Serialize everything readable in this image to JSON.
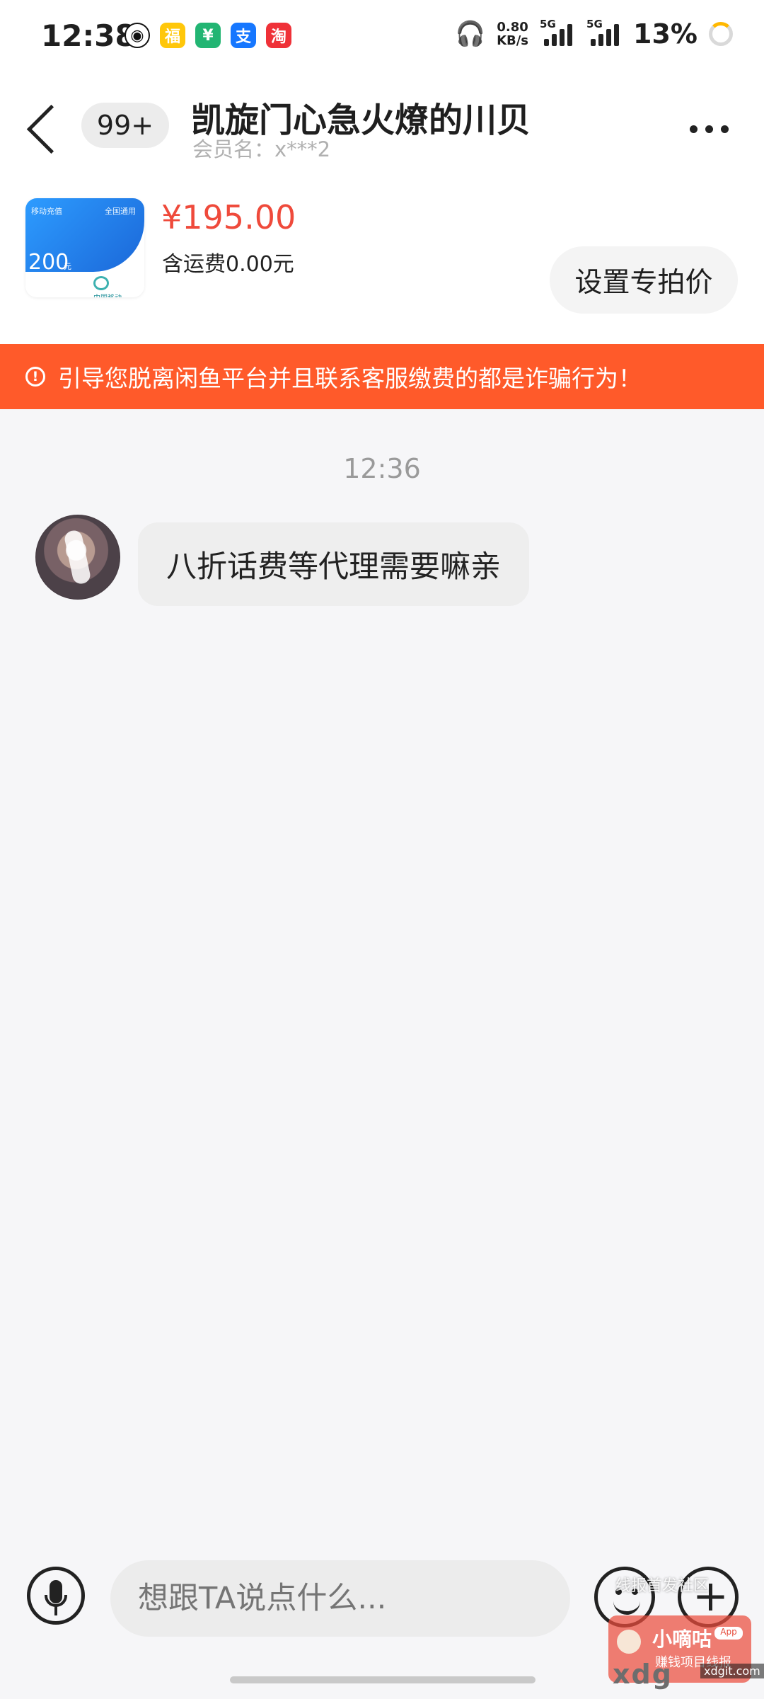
{
  "status_bar": {
    "time": "12:38",
    "speed_top": "0.80",
    "speed_bottom": "KB/s",
    "network_1": "5G",
    "network_2": "5G",
    "battery": "13%",
    "app_icons": [
      "qq-icon",
      "lucky-icon",
      "bank-icon",
      "alipay-icon",
      "taobao-icon"
    ]
  },
  "header": {
    "unread_badge": "99+",
    "title": "凯旋门心急火燎的川贝",
    "subtitle": "会员名：x***2"
  },
  "product": {
    "card_left_label": "移动充值",
    "card_right_label": "全国通用",
    "card_amount": "200",
    "card_unit": "元",
    "card_brand": "中国移动",
    "price": "¥195.00",
    "shipping": "含运费0.00元",
    "special_price_button": "设置专拍价"
  },
  "warning": {
    "text": "引导您脱离闲鱼平台并且联系客服缴费的都是诈骗行为！"
  },
  "messages": {
    "time": "12:36",
    "items": [
      {
        "text": "八折话费等代理需要嘛亲"
      }
    ]
  },
  "composer": {
    "placeholder": "想跟TA说点什么..."
  },
  "watermark": {
    "top_text": "线报首发社区",
    "title": "小嘀咕",
    "app": "App",
    "sub": "赚钱项目线报",
    "bottom": "xdg",
    "domain": "xdgit.com"
  },
  "colors": {
    "accent_orange": "#ff5a2a",
    "price_red": "#ef4a3b",
    "background": "#f6f6f8"
  }
}
